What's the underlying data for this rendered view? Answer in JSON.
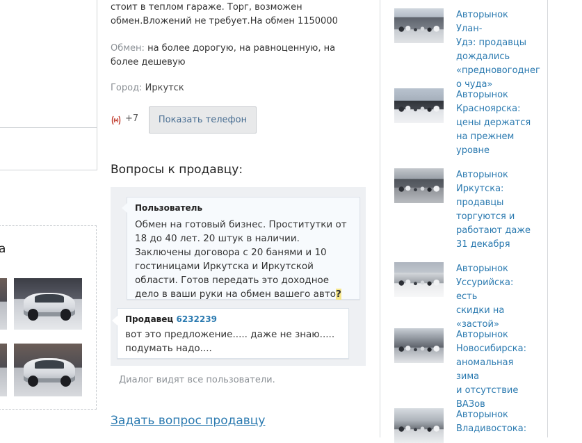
{
  "listing": {
    "description": "стоит в теплом гараже. Торг, возможен обмен.Вложений не требует.На обмен 1150000",
    "exchange_label": "Обмен:",
    "exchange_value": "на более дорогую, на равноценную, на более дешевую",
    "city_label": "Город:",
    "city_value": "Иркутск",
    "phone_prefix": "+7",
    "show_phone_button": "Показать телефон"
  },
  "left_column": {
    "fragment_letter": "а"
  },
  "questions": {
    "title": "Вопросы к продавцу:",
    "user_message": {
      "author": "Пользователь",
      "text": "Обмен на готовый бизнес. Проститутки от 18 до 40 лет. 20 штук в наличии. Заключены договора с 20 банями и 10 гостиницами Иркутска и Иркутской области. Готов передать это доходное дело в ваши руки на обмен вашего авто",
      "question_mark": "?"
    },
    "seller_message": {
      "author": "Продавец",
      "id": "6232239",
      "text": "вот это предложение..... даже не знаю..... подумать надо...."
    },
    "dialog_note": "Диалог видят все пользователи.",
    "ask_link": "Задать вопрос продавцу"
  },
  "news": [
    {
      "title": "Авторынок Улан-Удэ: продавцы дождались «предновогоднего чуда»",
      "lines": [
        "Авторынок Улан-",
        "Удэ: продавцы",
        "дождались",
        "«предновогоднег",
        "о чуда»"
      ]
    },
    {
      "title": "Авторынок Красноярска: цены держатся на прежнем уровне",
      "lines": [
        "Авторынок",
        "Красноярска:",
        "цены держатся",
        "на прежнем",
        "уровне"
      ]
    },
    {
      "title": "Авторынок Иркутска: продавцы торгуются и работают даже 31 декабря",
      "lines": [
        "Авторынок",
        "Иркутска:",
        "продавцы",
        "торгуются и",
        "работают даже",
        "31 декабря"
      ]
    },
    {
      "title": "Авторынок Уссурийска: есть скидки на «застой»",
      "lines": [
        "Авторынок",
        "Уссурийска: есть",
        "скидки на",
        "«застой»"
      ]
    },
    {
      "title": "Авторынок Новосибирска: аномальная зима и отсутствие ВАЗов",
      "lines": [
        "Авторынок",
        "Новосибирска:",
        "аномальная зима",
        "и отсутствие",
        "ВАЗов"
      ]
    },
    {
      "title": "Авторынок Владивостока:",
      "lines": [
        "Авторынок",
        "Владивостока:"
      ]
    }
  ],
  "icons": {
    "phone": "phone-signal-icon"
  },
  "colors": {
    "link": "#2b7ab0",
    "panel_bg": "#eef0f3",
    "button_bg": "#e8e9ea",
    "label_gray": "#8a8f94"
  }
}
